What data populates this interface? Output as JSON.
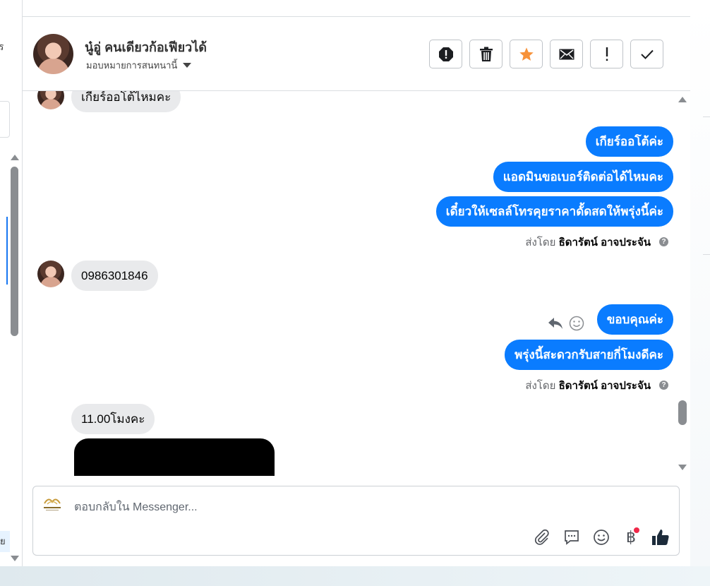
{
  "left_panel": {
    "cut_text_top": "ร",
    "cut_text_bottom": "ย"
  },
  "header": {
    "contact_name": "นู๋อู่ คนเดียวก้อเฟียวได้",
    "assign_label": "มอบหมายการสนทนานี้",
    "actions": [
      {
        "name": "spam-button",
        "icon": "block-icon"
      },
      {
        "name": "delete-button",
        "icon": "trash-icon"
      },
      {
        "name": "star-button",
        "icon": "star-icon"
      },
      {
        "name": "mark-unread-button",
        "icon": "mail-icon"
      },
      {
        "name": "follow-up-button",
        "icon": "exclamation-icon"
      },
      {
        "name": "done-button",
        "icon": "check-icon"
      }
    ],
    "accent_star": "#f7923a"
  },
  "messages": {
    "m1": "เกียร์ออโต้ไหมคะ",
    "m2": "เกียร์ออโต้ค่ะ",
    "m3": "แอดมินขอเบอร์ติดต่อได้ไหมคะ",
    "m4": "เดี๋ยวให้เซลล์โทรคุยราคาดั้ดสดให้พรุ่งนี้ค่ะ",
    "sent_by_prefix": "ส่งโดย",
    "sent_by_name": "ธิดารัตน์ อาจประจัน",
    "m5": "0986301846",
    "m6": "ขอบคุณค่ะ",
    "m7": "พรุ่งนี้สะดวกรับสายกี่โมงดีคะ",
    "m8": "11.00โมงคะ",
    "outgoing_color": "#0a7cff",
    "incoming_color": "#e9eaec"
  },
  "composer": {
    "placeholder": "ตอบกลับใน Messenger...",
    "currency_symbol": "฿",
    "tools": [
      "attach-icon",
      "saved-reply-icon",
      "emoji-icon",
      "payment-icon",
      "like-icon"
    ]
  }
}
